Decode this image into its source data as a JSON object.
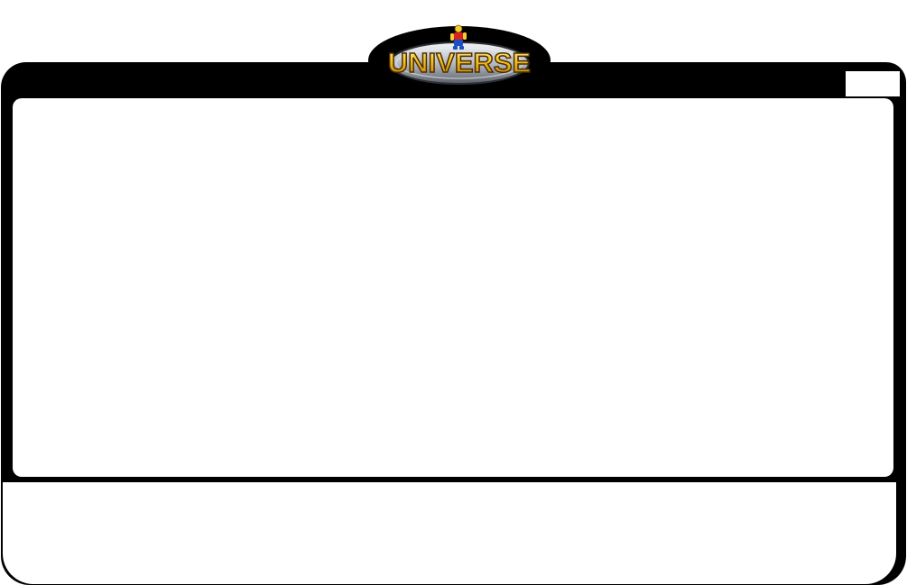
{
  "app": {
    "logo_text": "UNIVERSE"
  },
  "colors": {
    "frame": "#000000",
    "panel": "#ffffff",
    "logo_gold": "#f4c21f",
    "logo_silver": "#c7cbd1"
  },
  "icons": {
    "logo": "lego-universe-logo-icon",
    "minifig": "minifigure-icon"
  },
  "controls": {
    "close_label": ""
  }
}
